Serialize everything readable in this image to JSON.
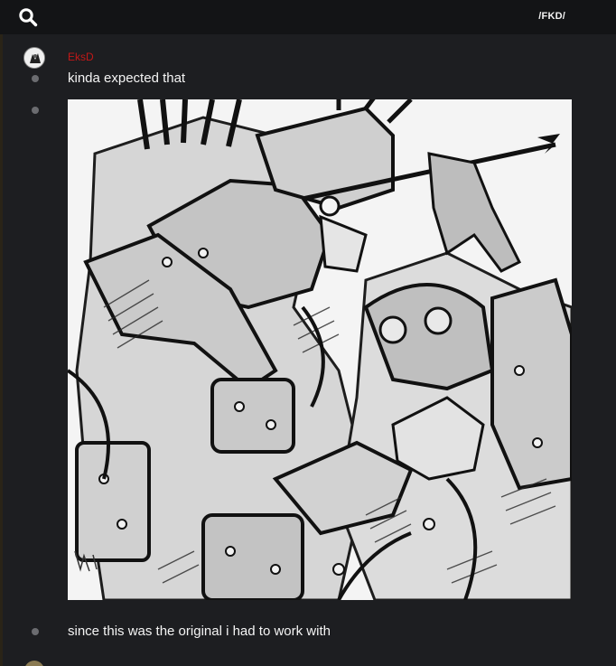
{
  "topbar": {
    "channel_label": "/FKD/"
  },
  "messages": [
    {
      "author": "EksD",
      "text": "kinda expected that"
    },
    {
      "image": "sketch-artwork"
    },
    {
      "text": "since this was the original i had to work with"
    }
  ],
  "colors": {
    "background": "#1d1e21",
    "topbar": "#131416",
    "author": "#c21818",
    "text": "#f4f4f4"
  }
}
